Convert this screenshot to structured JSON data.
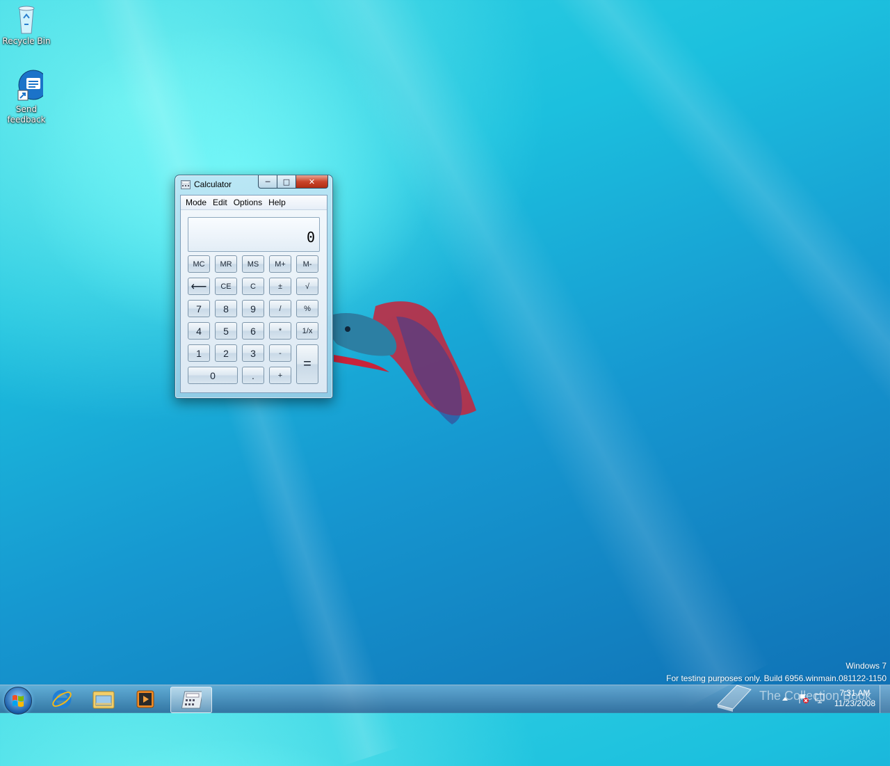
{
  "desktop": {
    "icons": [
      {
        "label": "Recycle Bin",
        "icon": "recycle-bin-icon"
      },
      {
        "label": "Send feedback",
        "icon": "send-feedback-icon"
      }
    ],
    "os_name": "Windows 7",
    "build_text": "For testing purposes only. Build 6956.winmain.081122-1150",
    "overlay_logo_text": "The Collection Book"
  },
  "calculator": {
    "title": "Calculator",
    "caption_buttons": {
      "minimize": "─",
      "maximize": "□",
      "close": "✕"
    },
    "menu": [
      "Mode",
      "Edit",
      "Options",
      "Help"
    ],
    "display_value": "0",
    "buttons": {
      "mc": "MC",
      "mr": "MR",
      "ms": "MS",
      "mplus": "M+",
      "mminus": "M-",
      "back": "⟵",
      "ce": "CE",
      "c": "C",
      "plusminus": "±",
      "sqrt": "√",
      "n7": "7",
      "n8": "8",
      "n9": "9",
      "div": "/",
      "pct": "%",
      "n4": "4",
      "n5": "5",
      "n6": "6",
      "mul": "*",
      "recip": "1/x",
      "n1": "1",
      "n2": "2",
      "n3": "3",
      "sub": "-",
      "eq": "=",
      "n0": "0",
      "dot": ".",
      "add": "+"
    }
  },
  "taskbar": {
    "pinned": [
      "internet-explorer-icon",
      "windows-explorer-icon",
      "media-player-icon",
      "calculator-icon"
    ],
    "clock_time": "7:31 AM",
    "clock_date": "11/23/2008"
  }
}
